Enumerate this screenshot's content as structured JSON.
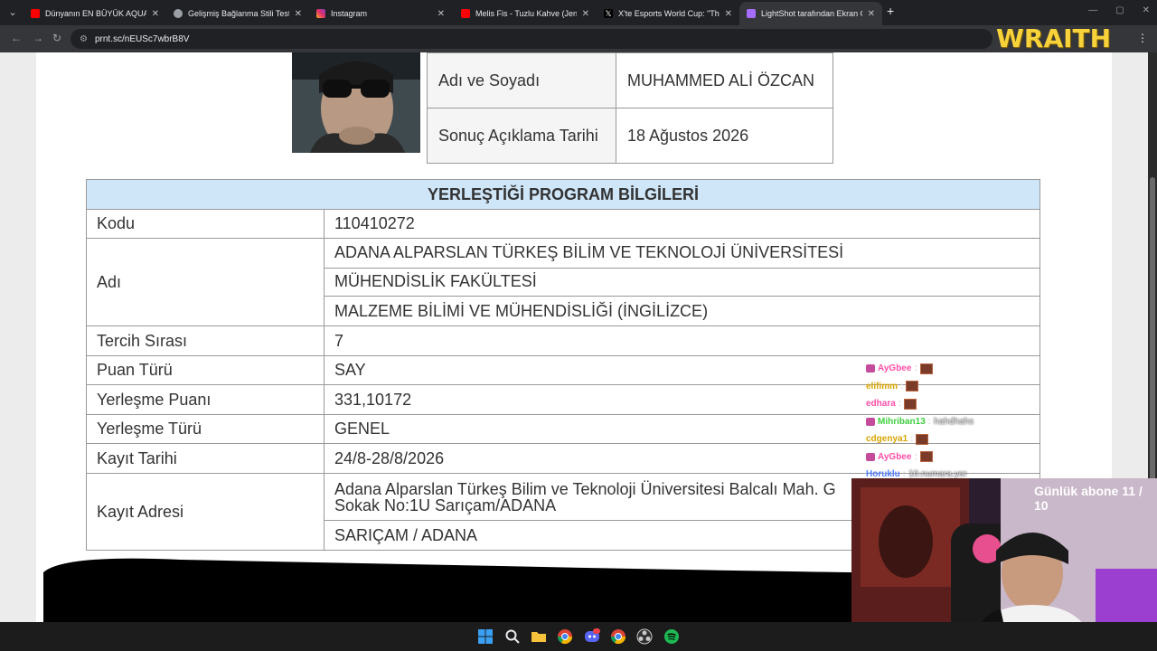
{
  "browser": {
    "tabs": [
      {
        "label": "Dünyanın EN BÜYÜK AQUAPARK",
        "icon": "youtube-icon",
        "color": "#ff0000"
      },
      {
        "label": "Gelişmiş Bağlanma Stili Testi",
        "icon": "globe-icon",
        "color": "#9aa0a6"
      },
      {
        "label": "Instagram",
        "icon": "instagram-icon",
        "color": "#e1306c"
      },
      {
        "label": "Melis Fis - Tuzlu Kahve (Jenerik",
        "icon": "youtube-icon",
        "color": "#ff0000"
      },
      {
        "label": "X'te Esports World Cup: \"The la",
        "icon": "x-icon",
        "color": "#ffffff"
      },
      {
        "label": "LightShot tarafından Ekran Görü",
        "icon": "lightshot-icon",
        "color": "#a66cff"
      }
    ],
    "url": "prnt.sc/nEUSc7wbrB8V",
    "brand_text": "WRAITH"
  },
  "info_table": {
    "rows": [
      {
        "key": "Adı ve Soyadı",
        "value": "MUHAMMED ALİ ÖZCAN"
      },
      {
        "key": "Sonuç Açıklama Tarihi",
        "value": "18 Ağustos 2026"
      }
    ]
  },
  "program": {
    "title": "YERLEŞTİĞİ PROGRAM BİLGİLERİ",
    "kodu_key": "Kodu",
    "kodu": "110410272",
    "adi_key": "Adı",
    "adi_lines": [
      "ADANA ALPARSLAN TÜRKEŞ BİLİM VE TEKNOLOJİ ÜNİVERSİTESİ",
      "MÜHENDİSLİK FAKÜLTESİ",
      "MALZEME BİLİMİ VE MÜHENDİSLİĞİ (İNGİLİZCE)"
    ],
    "tercih_key": "Tercih Sırası",
    "tercih": "7",
    "puan_turu_key": "Puan Türü",
    "puan_turu": "SAY",
    "puan_key": "Yerleşme Puanı",
    "puan": "331,10172",
    "yerlesme_turu_key": "Yerleşme Türü",
    "yerlesme_turu": "GENEL",
    "kayit_tarihi_key": "Kayıt Tarihi",
    "kayit_tarihi": "24/8-28/8/2026",
    "adres_key": "Kayıt Adresi",
    "adres_line1": "Adana Alparslan Türkeş Bilim ve Teknoloji Üniversitesi Balcalı Mah. G",
    "adres_line2": "Sokak No:1U Sarıçam/ADANA",
    "adres_line3": "SARIÇAM / ADANA"
  },
  "chat": [
    {
      "user": "AyGbee",
      "color": "#ff4fa8",
      "badge": true,
      "msg": "",
      "emote": true
    },
    {
      "user": "elifimm",
      "color": "#d9a400",
      "badge": false,
      "msg": "",
      "emote": true
    },
    {
      "user": "edhara",
      "color": "#ff4fa8",
      "badge": false,
      "msg": "",
      "emote": true
    },
    {
      "user": "Mihriban13",
      "color": "#3fcf3f",
      "badge": true,
      "msg": "hahdhahs",
      "emote": false
    },
    {
      "user": "cdgenya1",
      "color": "#d9a400",
      "badge": false,
      "msg": "",
      "emote": true
    },
    {
      "user": "AyGbee",
      "color": "#ff4fa8",
      "badge": true,
      "msg": "",
      "emote": true
    },
    {
      "user": "Horuklu",
      "color": "#4f7bff",
      "badge": false,
      "msg": "10.numara.yer",
      "emote": false
    }
  ],
  "stream": {
    "sub_goal": "Günlük abone 11 / 10"
  },
  "taskbar": {
    "apps": [
      "windows-start-icon",
      "search-icon",
      "file-explorer-icon",
      "chrome-icon",
      "discord-icon",
      "chrome-icon",
      "obs-icon",
      "spotify-icon"
    ],
    "discord_badge": "9+"
  }
}
